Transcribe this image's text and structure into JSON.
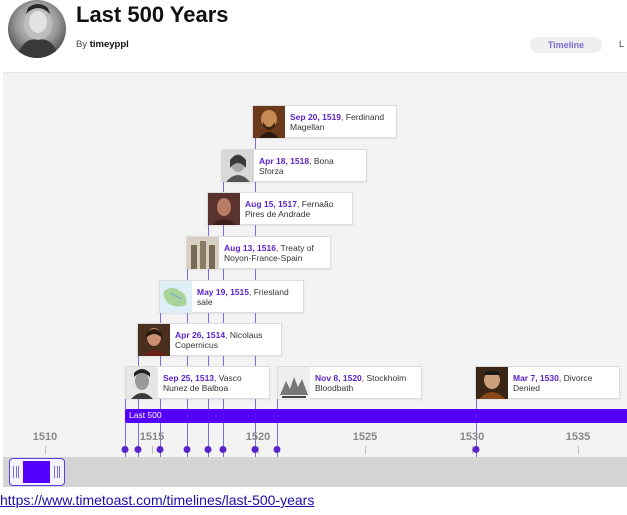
{
  "header": {
    "title": "Last 500 Years",
    "by_prefix": "By",
    "author": "timeyppl",
    "tabs": [
      {
        "label": "Timeline",
        "active": true
      },
      {
        "label": "L"
      }
    ]
  },
  "timeline": {
    "accent_color": "#5500ff",
    "date_color": "#5a23c8",
    "span": {
      "label": "Last 500"
    },
    "axis_ticks": [
      "1510",
      "1515",
      "1520",
      "1525",
      "1530",
      "1535"
    ],
    "events": [
      {
        "date": "Sep 20, 1519",
        "title": ", Ferdinand",
        "title2": "Magellan",
        "thumb_icon": "magellan-portrait-icon"
      },
      {
        "date": "Apr 18, 1518",
        "title": ", Bona",
        "title2": "Sforza",
        "thumb_icon": "sforza-portrait-icon"
      },
      {
        "date": "Aug 15, 1517",
        "title": ", Fernaão",
        "title2": "Pires de Andrade",
        "thumb_icon": "andrade-portrait-icon"
      },
      {
        "date": "Aug 13, 1516",
        "title": ", Treaty of",
        "title2": "Noyon-France-Spain",
        "thumb_icon": "building-icon"
      },
      {
        "date": "May 19, 1515",
        "title": ", Friesland",
        "title2": "sale",
        "thumb_icon": "map-icon"
      },
      {
        "date": "Apr 26, 1514",
        "title": ", Nicolaus",
        "title2": "Copernicus",
        "thumb_icon": "copernicus-portrait-icon"
      },
      {
        "date": "Sep 25, 1513",
        "title": ", Vasco",
        "title2": "Nunez de Balboa",
        "thumb_icon": "balboa-portrait-icon"
      },
      {
        "date": "Nov 8, 1520",
        "title": ", Stockholm",
        "title2": "Bloodbath",
        "thumb_icon": "engraving-icon"
      },
      {
        "date": "Mar 7, 1530",
        "title": ", Divorce",
        "title2": "Denied",
        "thumb_icon": "henry-portrait-icon"
      }
    ]
  },
  "footer": {
    "url": "https://www.timetoast.com/timelines/last-500-years"
  }
}
